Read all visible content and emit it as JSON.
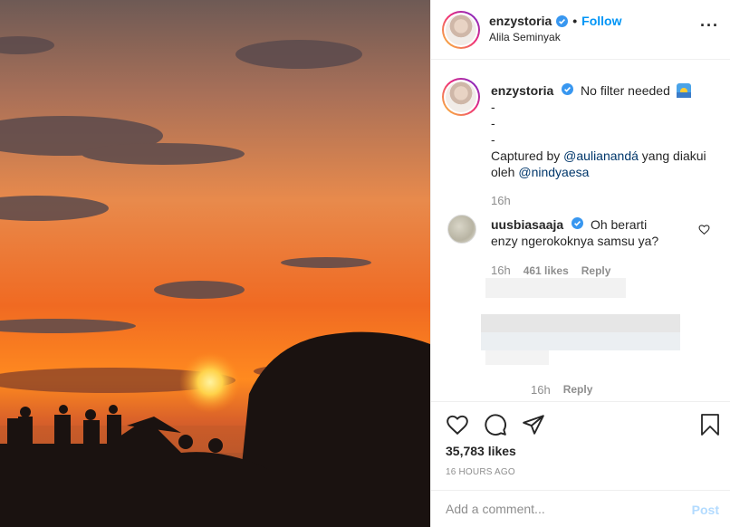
{
  "post": {
    "username": "enzystoria",
    "follow_label": "Follow",
    "location": "Alila Seminyak",
    "more_icon": "more-options-icon"
  },
  "caption": {
    "username": "enzystoria",
    "line1": "No filter needed",
    "dash1": "-",
    "dash2": "-",
    "dash3": "-",
    "captured_prefix": "Captured by",
    "mention1": "@aulianandá",
    "mid_text": "yang diakui oleh",
    "mention2": "@nindyaesa",
    "time": "16h"
  },
  "comment": {
    "username": "uusbiasaaja",
    "text": "Oh berarti enzy ngerokoknya samsu ya?",
    "time": "16h",
    "likes": "461 likes",
    "reply": "Reply"
  },
  "comment2": {
    "time": "16h",
    "reply": "Reply"
  },
  "stats": {
    "likes": "35,783 likes",
    "ago": "16 HOURS AGO"
  },
  "composer": {
    "placeholder": "Add a comment...",
    "post_label": "Post"
  },
  "colors": {
    "accent": "#0095f6",
    "mention": "#00376b",
    "muted": "#8e8e8e"
  }
}
